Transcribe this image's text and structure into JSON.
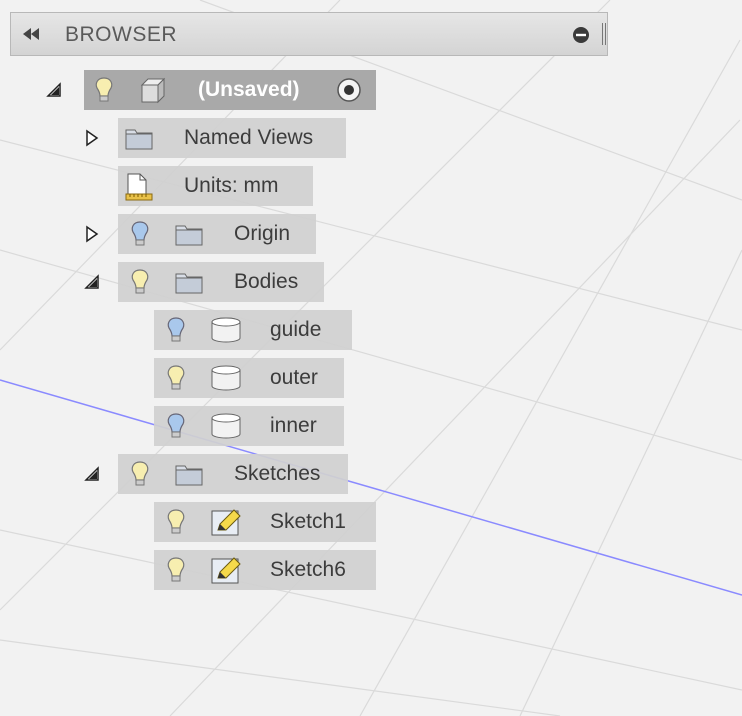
{
  "browser": {
    "title": "BROWSER",
    "collapse_icon": "rewind-icon",
    "pin_icon": "minus-circle-icon"
  },
  "tree": {
    "root": {
      "label": "(Unsaved)",
      "expanded": true,
      "active": true
    },
    "named_views": {
      "label": "Named Views",
      "expanded": false
    },
    "units": {
      "label": "Units: mm"
    },
    "origin": {
      "label": "Origin",
      "expanded": false,
      "visible": false
    },
    "bodies": {
      "label": "Bodies",
      "expanded": true,
      "visible": true,
      "items": [
        {
          "label": "guide",
          "visible": false
        },
        {
          "label": "outer",
          "visible": true
        },
        {
          "label": "inner",
          "visible": false
        }
      ]
    },
    "sketches": {
      "label": "Sketches",
      "expanded": true,
      "visible": true,
      "items": [
        {
          "label": "Sketch1",
          "visible": true
        },
        {
          "label": "Sketch6",
          "visible": true
        }
      ]
    }
  },
  "colors": {
    "bulb_on": "#f7eeb0",
    "bulb_off": "#a9c8ec",
    "axis_line": "#8080ff",
    "grid_line": "#d9d9d9"
  }
}
